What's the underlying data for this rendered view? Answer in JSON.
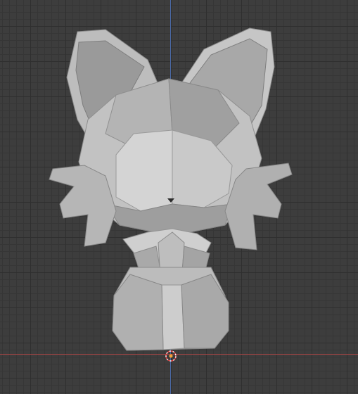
{
  "viewport": {
    "mode": "3d-viewport",
    "background": "#3d3d3d",
    "grid_color": "#2f2f2f",
    "axis_x_color": "#a84545",
    "axis_y_color": "#4a6aa8",
    "model": "low-poly-fox-character",
    "model_color": "#b8b8b8"
  }
}
